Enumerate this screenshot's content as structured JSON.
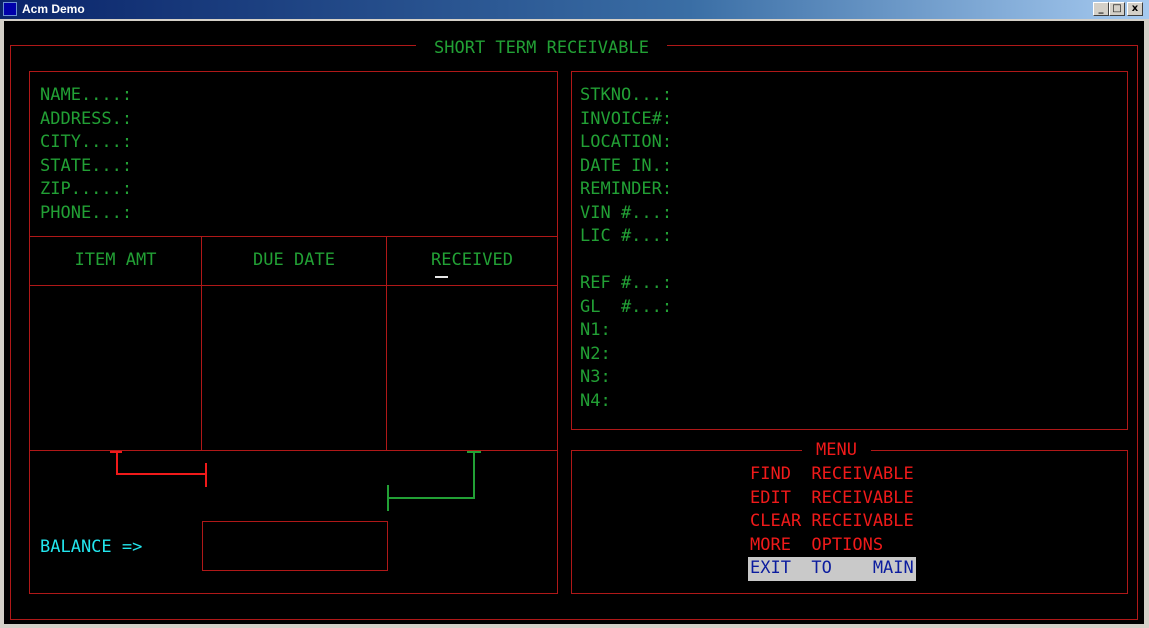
{
  "window": {
    "title": "Acm Demo",
    "minimize": "_",
    "maximize": "□",
    "close": "x"
  },
  "screen": {
    "title": "SHORT TERM RECEIVABLE",
    "customer_fields": [
      "NAME....:",
      "ADDRESS.:",
      "CITY....:",
      "STATE...:",
      "ZIP.....:",
      "PHONE...:"
    ],
    "table_headers": [
      "ITEM AMT",
      "DUE DATE",
      "RECEIVED"
    ],
    "vehicle_fields": [
      "STKNO...:",
      "INVOICE#:",
      "LOCATION:",
      "DATE IN.:",
      "REMINDER:",
      "VIN #...:",
      "LIC #...:"
    ],
    "ref_fields": [
      "REF #...:",
      "GL  #...:",
      "N1:",
      "N2:",
      "N3:",
      "N4:"
    ],
    "balance_label": "BALANCE =>",
    "balance_value": "",
    "menu": {
      "title": "MENU",
      "items": [
        {
          "label": "FIND  RECEIVABLE"
        },
        {
          "label": "EDIT  RECEIVABLE"
        },
        {
          "label": "CLEAR RECEIVABLE"
        },
        {
          "label": "MORE  OPTIONS"
        },
        {
          "label": "EXIT  TO    MAIN"
        }
      ]
    }
  }
}
